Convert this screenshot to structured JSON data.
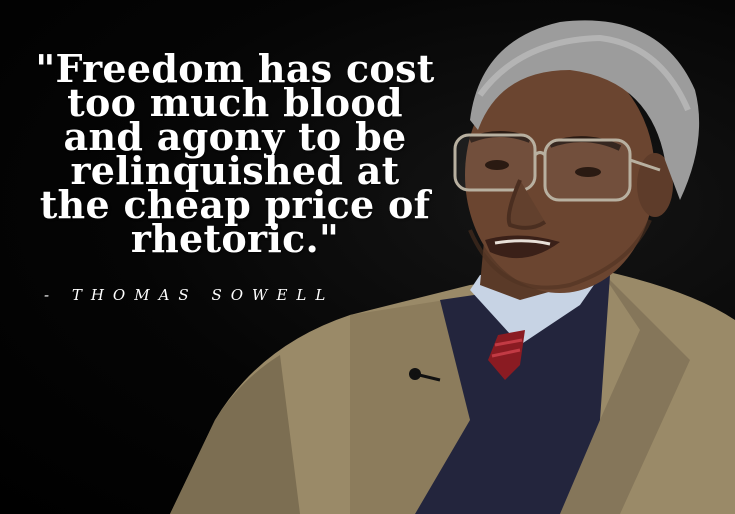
{
  "quote": {
    "lines": [
      "\"Freedom has cost",
      "too much blood",
      "and agony to be",
      "relinquished at",
      "the cheap price of",
      "rhetoric.\""
    ]
  },
  "attribution": "- THOMAS SOWELL",
  "colors": {
    "background": "#000000",
    "text": "#ffffff",
    "jacket": "#9a8a68",
    "sweater": "#23253d",
    "tie": "#8a1b22",
    "skin": "#6b4530",
    "hair": "#9c9c9c"
  }
}
